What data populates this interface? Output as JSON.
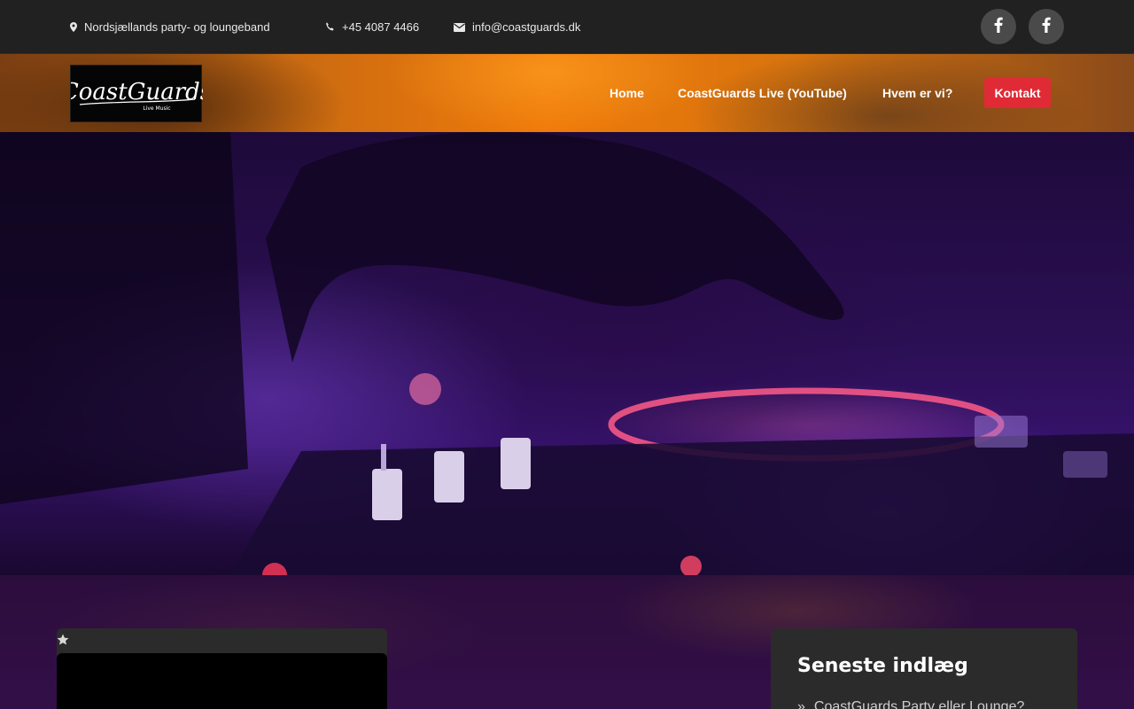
{
  "topbar": {
    "location": "Nordsjællands party- og loungeband",
    "phone": "+45 4087 4466",
    "email": "info@coastguards.dk",
    "social": [
      {
        "icon": "facebook-icon",
        "label": "f"
      },
      {
        "icon": "facebook-icon",
        "label": "f"
      }
    ]
  },
  "logo": {
    "main": "CoastGuards",
    "sub": "Live Music"
  },
  "nav": {
    "items": [
      {
        "label": "Home"
      },
      {
        "label": "CoastGuards Live (YouTube)"
      },
      {
        "label": "Hvem er vi?"
      }
    ],
    "contact": "Kontakt"
  },
  "hero": {
    "image": "dj-mixer-photo"
  },
  "sidebar": {
    "title": "Seneste indlæg",
    "posts": [
      {
        "label": "CoastGuards Party eller Lounge?"
      }
    ],
    "bullet": "»"
  },
  "colors": {
    "topbar_bg": "#212121",
    "accent": "#e02a35",
    "card_bg": "#2b2b2b",
    "social_bg": "#4a4a4a"
  }
}
